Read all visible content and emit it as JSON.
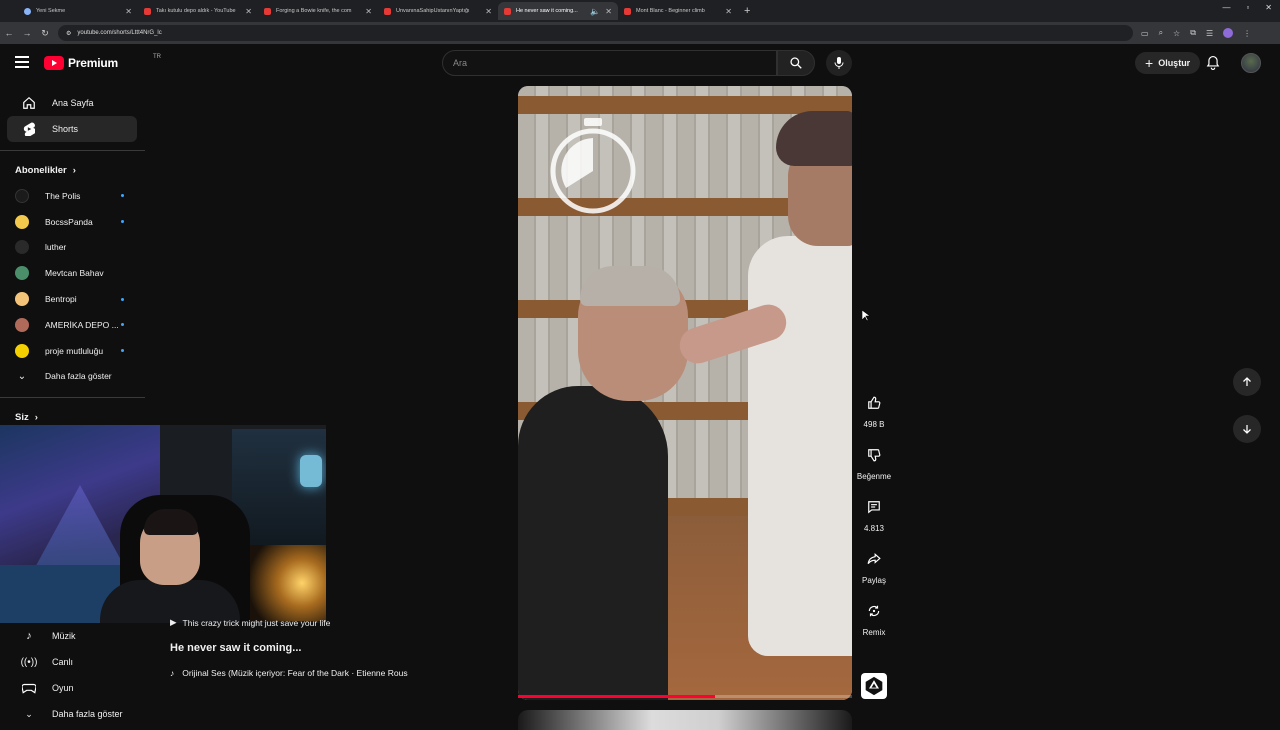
{
  "browser": {
    "tabs": [
      {
        "title": "Yeni Sekme",
        "active": false
      },
      {
        "title": "Takı kutulu depo aldık - YouTube",
        "active": false
      },
      {
        "title": "Forging a Bowie knife, the com",
        "active": false
      },
      {
        "title": "ÜnvanınaSahipUstanınYaptığı",
        "active": false
      },
      {
        "title": "He never saw it coming...",
        "active": true
      },
      {
        "title": "Mont Blanc - Beginner climb",
        "active": false
      }
    ],
    "url": "youtube.com/shorts/Lttt4NrG_lc"
  },
  "header": {
    "logo_text": "Premium",
    "country": "TR",
    "search_placeholder": "Ara",
    "create_label": "Oluştur"
  },
  "sidebar": {
    "main": [
      {
        "label": "Ana Sayfa",
        "icon": "home-icon",
        "active": false
      },
      {
        "label": "Shorts",
        "icon": "shorts-icon",
        "active": true
      }
    ],
    "subscriptions_title": "Abonelikler",
    "subscriptions": [
      {
        "name": "The Polis",
        "dot": true,
        "color": "#1b1b1b"
      },
      {
        "name": "BocssPanda",
        "dot": true,
        "color": "#f2c94c"
      },
      {
        "name": "luther",
        "dot": false,
        "color": "#2a2a2a"
      },
      {
        "name": "Mevtcan Bahav",
        "dot": false,
        "color": "#4a8f6a"
      },
      {
        "name": "Bentropi",
        "dot": true,
        "color": "#f4c37a"
      },
      {
        "name": "AMERİKA DEPO ...",
        "dot": true,
        "color": "#b06a5a"
      },
      {
        "name": "proje mutluluğu",
        "dot": true,
        "color": "#f5d000"
      }
    ],
    "show_more": "Daha fazla göster",
    "you_title": "Siz",
    "bottom": [
      {
        "label": "Müzik",
        "icon": "music-icon"
      },
      {
        "label": "Canlı",
        "icon": "live-icon"
      },
      {
        "label": "Oyun",
        "icon": "gaming-icon"
      }
    ],
    "bottom_more": "Daha fazla göster"
  },
  "short": {
    "subtitle": "This crazy trick might just save your life",
    "title": "He never saw it coming...",
    "music": "Orijinal Ses (Müzik içeriyor: Fear of the Dark · Etienne Rous",
    "progress": 0.59
  },
  "actions": {
    "like_count": "498 B",
    "dislike_label": "Beğenme",
    "comment_count": "4.813",
    "share_label": "Paylaş",
    "remix_label": "Remix"
  },
  "colors": {
    "brand": "#ff0033",
    "background": "#0f0f0f",
    "unread_dot": "#3ea6ff"
  }
}
